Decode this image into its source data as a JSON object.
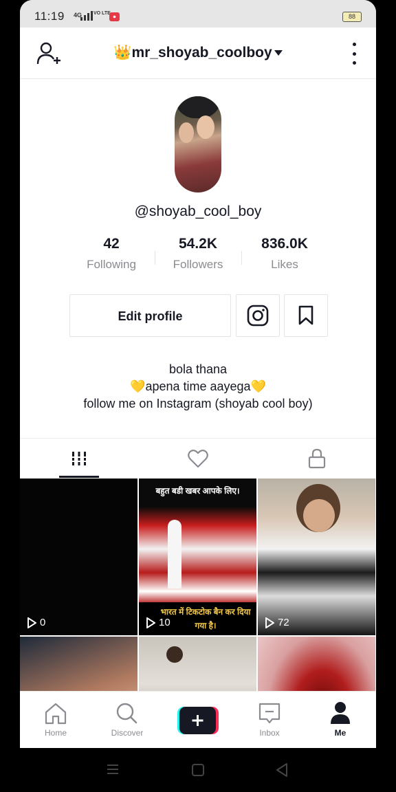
{
  "status": {
    "time": "11:19",
    "network": "4G",
    "volte": "VO LTE",
    "battery": "88"
  },
  "header": {
    "crown": "👑",
    "username": "mr_shoyab_coolboy"
  },
  "profile": {
    "handle": "@shoyab_cool_boy",
    "stats": [
      {
        "value": "42",
        "label": "Following"
      },
      {
        "value": "54.2K",
        "label": "Followers"
      },
      {
        "value": "836.0K",
        "label": "Likes"
      }
    ],
    "edit_label": "Edit profile",
    "bio_line1": "bola thana",
    "bio_line2_heart": "💛",
    "bio_line2": "apena time aayega",
    "bio_line3": "follow me on Instagram (shoyab cool boy)"
  },
  "tabs": [
    {
      "name": "videos",
      "icon": "grid-icon",
      "active": true
    },
    {
      "name": "liked",
      "icon": "heart-outline-icon",
      "active": false
    },
    {
      "name": "private",
      "icon": "lock-icon",
      "active": false
    }
  ],
  "videos": [
    {
      "views": "0"
    },
    {
      "views": "10",
      "top_text": "बहुत बडी खबर आपके लिए।",
      "bottom_text": "भारत में टिकटोक बैन कर दिया गया है।"
    },
    {
      "views": "72"
    }
  ],
  "nav": [
    {
      "label": "Home",
      "icon": "home-icon"
    },
    {
      "label": "Discover",
      "icon": "search-icon"
    },
    {
      "label": "",
      "icon": "plus-icon"
    },
    {
      "label": "Inbox",
      "icon": "inbox-icon"
    },
    {
      "label": "Me",
      "icon": "person-icon",
      "active": true
    }
  ],
  "colors": {
    "accent_cyan": "#25f4ee",
    "accent_red": "#fe2c55",
    "text": "#161823",
    "muted": "#8a8b91"
  }
}
